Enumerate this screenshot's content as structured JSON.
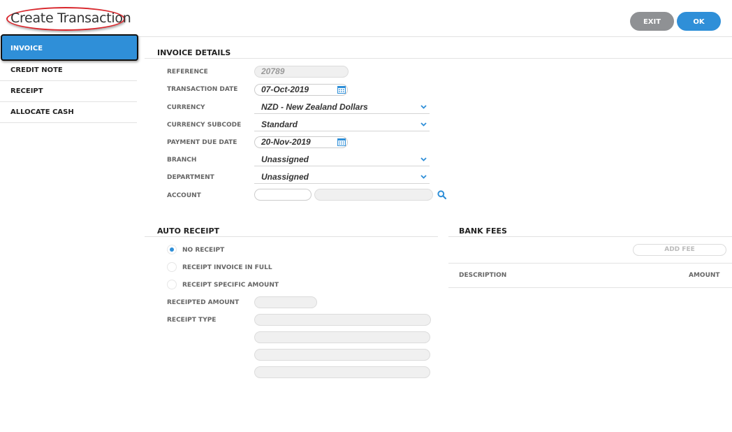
{
  "header": {
    "title": "Create Transaction",
    "exit_label": "EXIT",
    "ok_label": "OK"
  },
  "sidebar": {
    "items": [
      {
        "label": "INVOICE",
        "active": true
      },
      {
        "label": "CREDIT NOTE",
        "active": false
      },
      {
        "label": "RECEIPT",
        "active": false
      },
      {
        "label": "ALLOCATE CASH",
        "active": false
      }
    ]
  },
  "invoice_details": {
    "title": "INVOICE DETAILS",
    "reference": {
      "label": "REFERENCE",
      "value": "20789"
    },
    "transaction_date": {
      "label": "TRANSACTION DATE",
      "value": "07-Oct-2019"
    },
    "currency": {
      "label": "CURRENCY",
      "value": "NZD - New Zealand Dollars"
    },
    "currency_subcode": {
      "label": "CURRENCY SUBCODE",
      "value": "Standard"
    },
    "payment_due_date": {
      "label": "PAYMENT DUE DATE",
      "value": "20-Nov-2019"
    },
    "branch": {
      "label": "BRANCH",
      "value": "Unassigned"
    },
    "department": {
      "label": "DEPARTMENT",
      "value": "Unassigned"
    },
    "account": {
      "label": "ACCOUNT",
      "code": "",
      "name": ""
    }
  },
  "auto_receipt": {
    "title": "AUTO RECEIPT",
    "options": [
      {
        "label": "NO RECEIPT",
        "selected": true
      },
      {
        "label": "RECEIPT INVOICE IN FULL",
        "selected": false
      },
      {
        "label": "RECEIPT SPECIFIC AMOUNT",
        "selected": false
      }
    ],
    "receipted_amount_label": "RECEIPTED AMOUNT",
    "receipt_type_label": "RECEIPT TYPE"
  },
  "bank_fees": {
    "title": "BANK FEES",
    "add_fee_label": "ADD FEE",
    "columns": [
      "DESCRIPTION",
      "AMOUNT"
    ]
  },
  "colors": {
    "accent": "#2f8fd8",
    "exit_button": "#8f9194",
    "title_highlight": "#d9262c"
  },
  "icons": {
    "calendar": "calendar-icon",
    "dropdown": "chevron-down-icon",
    "search": "search-icon"
  }
}
